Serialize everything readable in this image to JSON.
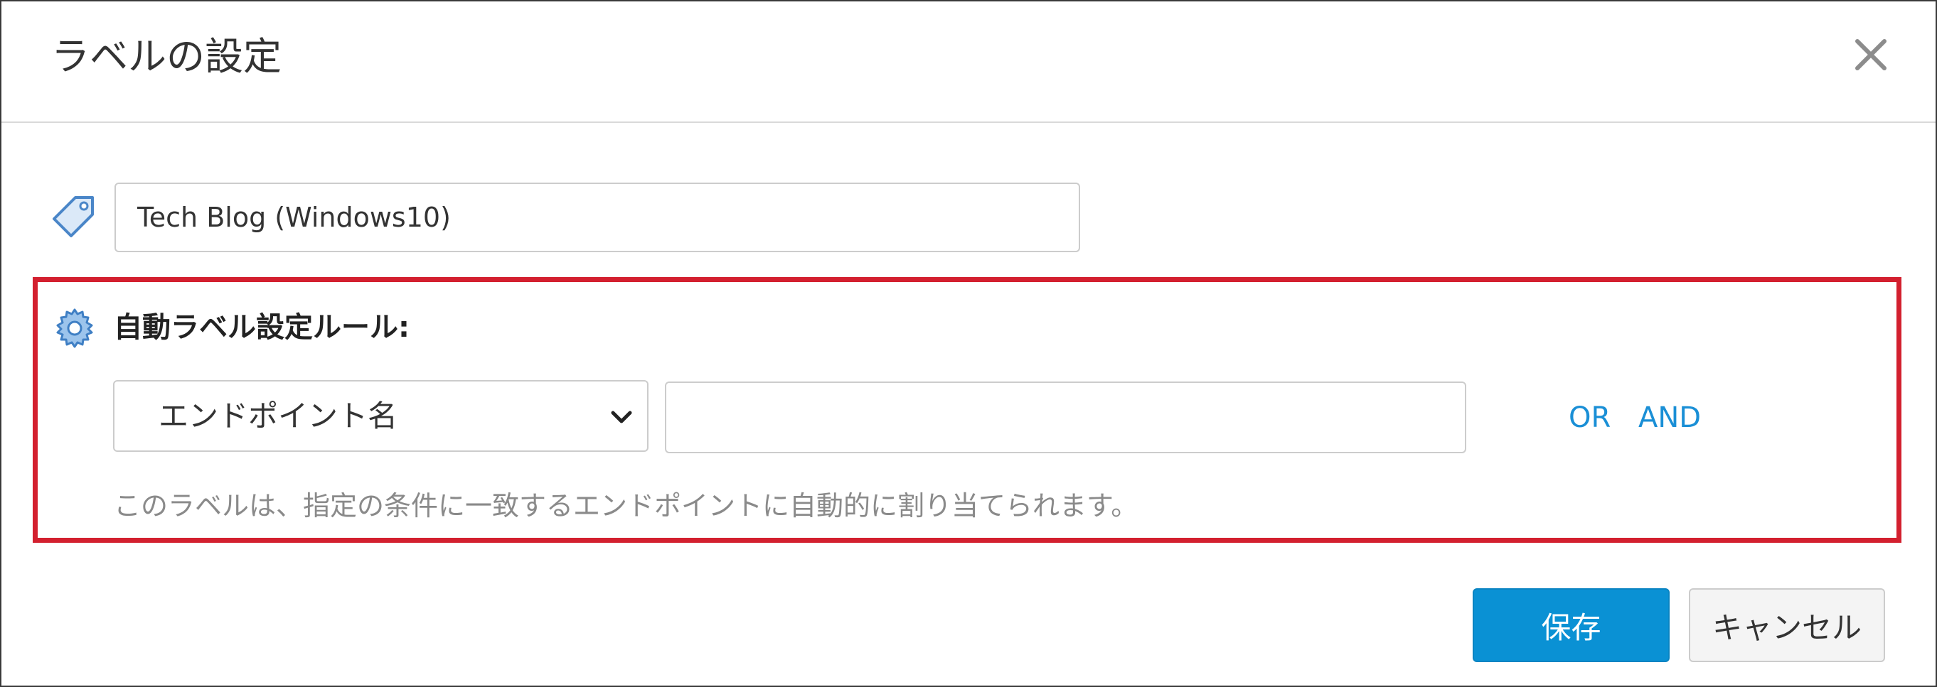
{
  "dialog": {
    "title": "ラベルの設定",
    "close_icon": "close-icon"
  },
  "label": {
    "icon": "tag-icon",
    "value": "Tech Blog (Windows10)"
  },
  "rule": {
    "icon": "gear-icon",
    "title": "自動ラベル設定ルール:",
    "field_select": {
      "selected": "エンドポイント名",
      "icon": "chevron-down-icon"
    },
    "value_input": {
      "value": ""
    },
    "operators": {
      "or_label": "OR",
      "and_label": "AND"
    },
    "help_text": "このラベルは、指定の条件に一致するエンドポイントに自動的に割り当てられます。",
    "highlight_color": "#d3202f"
  },
  "footer": {
    "save_label": "保存",
    "cancel_label": "キャンセル"
  },
  "colors": {
    "accent": "#0a91d4",
    "link": "#1a8fd6"
  }
}
